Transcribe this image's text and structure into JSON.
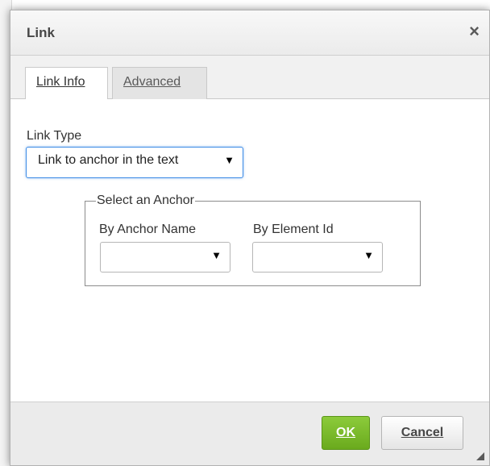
{
  "dialog": {
    "title": "Link",
    "close_glyph": "×"
  },
  "tabs": [
    {
      "label": "Link Info",
      "active": true
    },
    {
      "label": "Advanced",
      "active": false
    }
  ],
  "link_type": {
    "label": "Link Type",
    "selected": "Link to anchor in the text",
    "arrow": "▼"
  },
  "anchor_group": {
    "legend": "Select an Anchor",
    "by_name": {
      "label": "By Anchor Name",
      "selected": "",
      "arrow": "▼"
    },
    "by_id": {
      "label": "By Element Id",
      "selected": "",
      "arrow": "▼"
    }
  },
  "buttons": {
    "ok": "OK",
    "cancel": "Cancel"
  },
  "colors": {
    "ok_button": "#7ab92e",
    "focus_border": "#3e8ce6",
    "title_bar": "#eeeeee"
  },
  "icons": {
    "close": "close-icon",
    "dropdown": "chevron-down-icon",
    "resize": "resize-grip-icon"
  }
}
